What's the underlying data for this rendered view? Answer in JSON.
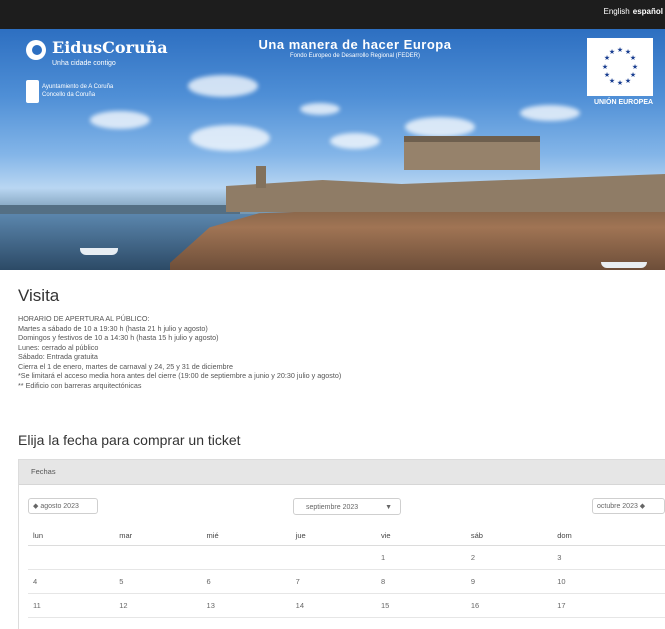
{
  "top_bar": {
    "languages": [
      {
        "label": "English",
        "active": false
      },
      {
        "label": "español",
        "active": true
      }
    ]
  },
  "banner": {
    "logo_title": "EidusCoruña",
    "logo_subtitle": "Unha cidade contigo",
    "council_line1": "Ayuntamiento de A Coruña",
    "council_line2": "Concello da Coruña",
    "motto_title": "Una manera de hacer Europa",
    "motto_subtitle": "Fondo Europeo de Desarrollo Regional (FEDER)",
    "eu_label": "UNIÓN EUROPEA"
  },
  "page": {
    "title": "Visita",
    "info_lines": [
      "HORARIO DE APERTURA AL PÚBLICO:",
      "Martes a sábado de 10 a 19:30 h (hasta 21 h julio y agosto)",
      "Domingos y festivos de 10 a 14:30 h (hasta 15 h julio y agosto)",
      "Lunes: cerrado al público",
      "Sábado: Entrada gratuita",
      "Cierra el 1 de enero, martes de carnaval y 24, 25 y 31 de diciembre",
      "*Se limitará el acceso media hora antes del cierre (19:00 de septiembre a junio y 20:30 julio y agosto)",
      "** Edificio con barreras arquitectónicas"
    ],
    "section_title": "Elija la fecha para comprar un ticket"
  },
  "calendar": {
    "panel_heading": "Fechas",
    "prev_label": "◆ agosto 2023",
    "next_label": "octubre 2023 ◆",
    "month_select": "septiembre 2023",
    "weekdays": [
      "lun",
      "mar",
      "mié",
      "jue",
      "vie",
      "sáb",
      "dom"
    ],
    "weeks": [
      [
        "",
        "",
        "",
        "",
        "1",
        "2",
        "3"
      ],
      [
        "4",
        "5",
        "6",
        "7",
        "8",
        "9",
        "10"
      ],
      [
        "11",
        "12",
        "13",
        "14",
        "15",
        "16",
        "17"
      ]
    ]
  },
  "colors": {
    "top_bar": "#1d1d1d",
    "panel_header": "#e6e6e6"
  }
}
